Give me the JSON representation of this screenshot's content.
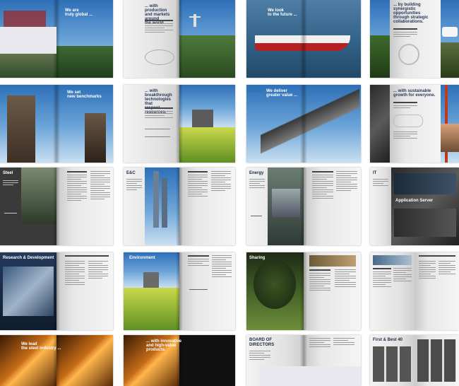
{
  "headlines": {
    "h1": [
      "We are",
      "truly global ..."
    ],
    "h2": [
      "... with production",
      "and markets around",
      "the world."
    ],
    "h3": [
      "We look",
      "to the future ..."
    ],
    "h4": [
      "... by building",
      "synergistic",
      "opportunities",
      "through strategic",
      "collaborations."
    ],
    "h5": [
      "We set",
      "new benchmarks"
    ],
    "h6": [
      "... with breakthrough",
      "technologies that",
      "respect resources."
    ],
    "h7": [
      "We deliver",
      "greater value ..."
    ],
    "h8": [
      "... with sustainable",
      "growth for everyone."
    ],
    "h9": [
      "We lead",
      "the steel industry ..."
    ],
    "h10": [
      "... with innovative",
      "and high-value",
      "products."
    ]
  },
  "sections": {
    "steel": "Steel",
    "ec": "E&C",
    "energy": "Energy",
    "it": "IT",
    "it_banner": "Application Server",
    "rd": "Research & Development",
    "environment": "Environment",
    "sharing": "Sharing",
    "board": [
      "BOARD OF",
      "DIRECTORS"
    ],
    "first_best": "First & Best 40"
  },
  "colors": {
    "headline_text": "#ffffff",
    "accent_blue": "#2d74b8",
    "blank_block": "#e8e8ee"
  }
}
